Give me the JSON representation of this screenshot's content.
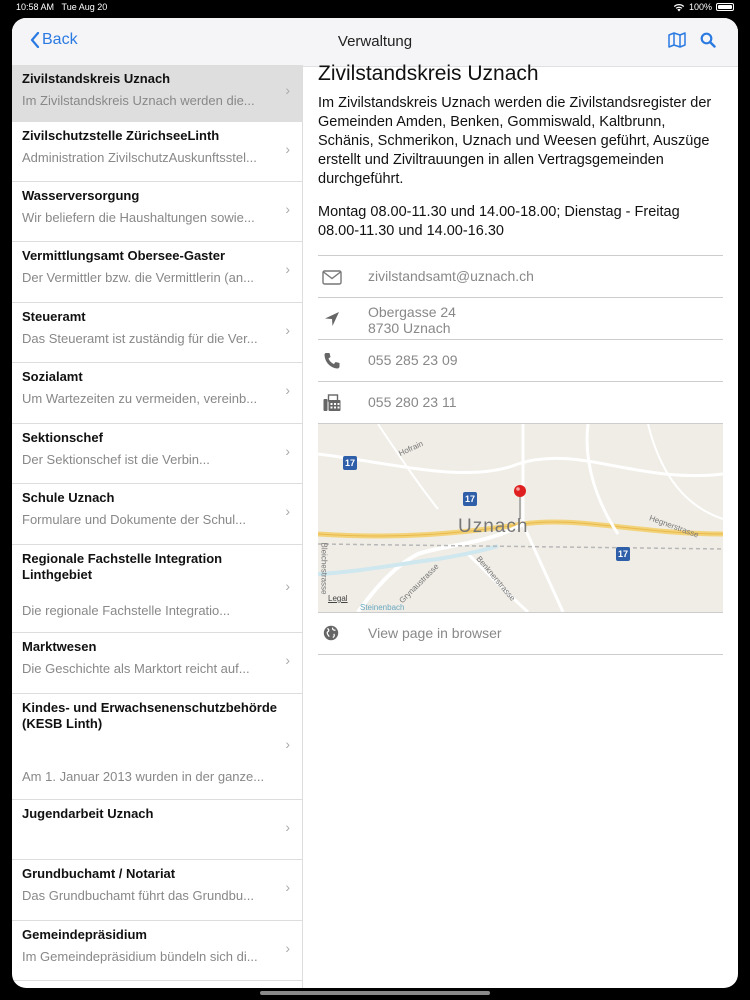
{
  "status": {
    "time": "10:58 AM",
    "date": "Tue Aug 20",
    "battery": "100%"
  },
  "nav": {
    "back_label": "Back",
    "title": "Verwaltung"
  },
  "list": [
    {
      "title": "Zivilstandskreis Uznach",
      "subtitle": "Im Zivilstandskreis Uznach werden die...",
      "selected": true
    },
    {
      "title": "Zivilschutzstelle ZürichseeLinth",
      "subtitle": "Administration ZivilschutzAuskunftsstel..."
    },
    {
      "title": "Wasserversorgung",
      "subtitle": "Wir beliefern die Haushaltungen sowie..."
    },
    {
      "title": "Vermittlungsamt Obersee-Gaster",
      "subtitle": "Der Vermittler bzw. die Vermittlerin (an..."
    },
    {
      "title": "Steueramt",
      "subtitle": "Das Steueramt ist zuständig für die Ver..."
    },
    {
      "title": "Sozialamt",
      "subtitle": "Um Wartezeiten zu vermeiden, vereinb..."
    },
    {
      "title": "Sektionschef",
      "subtitle": "Der Sektionschef ist die Verbin..."
    },
    {
      "title": "Schule Uznach",
      "subtitle": "Formulare und Dokumente der Schul..."
    },
    {
      "title": "Regionale Fachstelle Integration Linthgebiet",
      "subtitle": "Die regionale Fachstelle Integratio..."
    },
    {
      "title": "Marktwesen",
      "subtitle": "Die Geschichte als Marktort reicht auf..."
    },
    {
      "title": "Kindes- und Erwachsenenschutzbehörde (KESB Linth)",
      "subtitle": "Am 1. Januar 2013 wurden in der ganze..."
    },
    {
      "title": "Jugendarbeit Uznach",
      "subtitle": ""
    },
    {
      "title": "Grundbuchamt / Notariat",
      "subtitle": "Das Grundbuchamt führt das Grundbu..."
    },
    {
      "title": "Gemeindepräsidium",
      "subtitle": "Im Gemeindepräsidium bündeln sich di..."
    }
  ],
  "detail": {
    "title": "Zivilstandskreis Uznach",
    "description": "Im Zivilstandskreis Uznach werden die Zivilstandsregister der Gemeinden Amden, Benken, Gommiswald, Kaltbrunn, Schänis, Schmerikon, Uznach und Weesen geführt, Auszüge erstellt und Ziviltrauungen in allen Vertragsgemeinden durchgeführt.",
    "hours": "Montag 08.00-11.30 und 14.00-18.00; Dienstag - Freitag 08.00-11.30 und 14.00-16.30",
    "email": "zivilstandsamt@uznach.ch",
    "address_line1": "Obergasse 24",
    "address_line2": "8730 Uznach",
    "phone": "055 285 23 09",
    "fax": "055 280 23 11",
    "link_label": "View page in browser"
  },
  "map": {
    "city": "Uznach",
    "route_number": "17",
    "streets": [
      "Hofrain",
      "Hegnerstrasse",
      "Bleichestrasse",
      "Grynaustrasse",
      "Benknerstrasse",
      "Steinenbach"
    ],
    "legal": "Legal"
  },
  "colors": {
    "accent": "#2a7ae2",
    "selected_row": "#dedede",
    "pin": "#e02020"
  }
}
